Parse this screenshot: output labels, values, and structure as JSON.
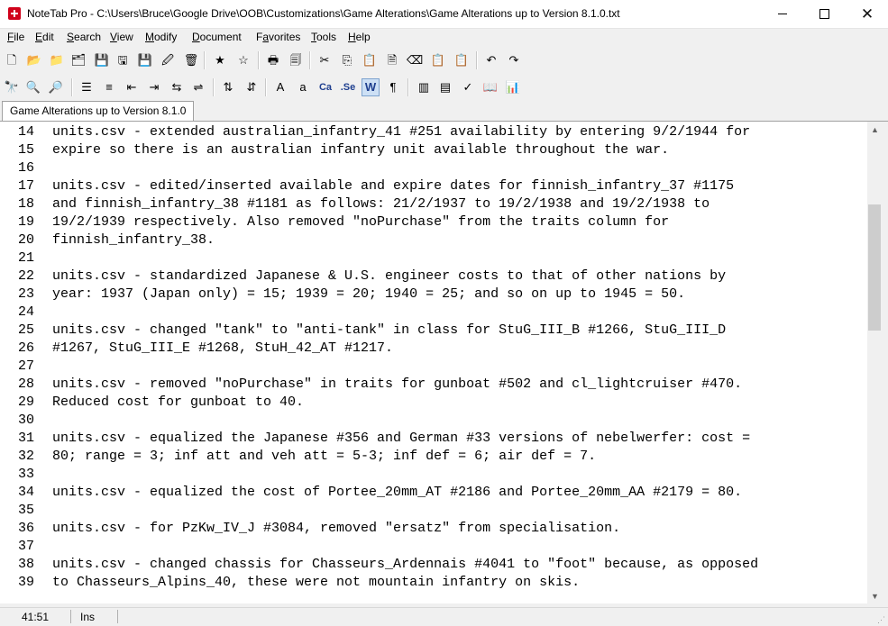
{
  "window": {
    "title": "NoteTab Pro  -  C:\\Users\\Bruce\\Google Drive\\OOB\\Customizations\\Game Alterations\\Game Alterations up to Version 8.1.0.txt"
  },
  "menu": [
    {
      "label": "File",
      "key": "F",
      "rest": "ile"
    },
    {
      "label": "Edit",
      "key": "E",
      "rest": "dit"
    },
    {
      "label": "Search",
      "key": "S",
      "rest": "earch"
    },
    {
      "label": "View",
      "key": "V",
      "rest": "iew"
    },
    {
      "label": "Modify",
      "key": "M",
      "rest": "odify"
    },
    {
      "label": "Document",
      "key": "D",
      "rest": "ocument"
    },
    {
      "label": "Favorites",
      "key": "a",
      "pre": "F",
      "rest": "vorites"
    },
    {
      "label": "Tools",
      "key": "T",
      "rest": "ools"
    },
    {
      "label": "Help",
      "key": "H",
      "rest": "elp"
    }
  ],
  "toolbar1": [
    {
      "icon": "new-document-icon",
      "glyph": "🗋"
    },
    {
      "icon": "open-folder-icon",
      "glyph": "📂"
    },
    {
      "icon": "open-folder-alt-icon",
      "glyph": "📁"
    },
    {
      "icon": "open-multiple-icon",
      "glyph": "🗂"
    },
    {
      "icon": "save-icon",
      "glyph": "💾"
    },
    {
      "icon": "save-all-icon",
      "glyph": "🖫"
    },
    {
      "icon": "save-as-icon",
      "glyph": "💾"
    },
    {
      "icon": "save-edit-icon",
      "glyph": "🖉"
    },
    {
      "icon": "trash-icon",
      "glyph": "🗑"
    },
    {
      "icon": "favorites-add-icon",
      "glyph": "★"
    },
    {
      "icon": "favorites-icon",
      "glyph": "☆"
    },
    {
      "icon": "print-icon",
      "glyph": "🖶"
    },
    {
      "icon": "print-preview-icon",
      "glyph": "🗐"
    },
    {
      "icon": "cut-icon",
      "glyph": "✂"
    },
    {
      "icon": "copy-icon",
      "glyph": "⎘"
    },
    {
      "icon": "paste-icon",
      "glyph": "📋"
    },
    {
      "icon": "paste-special-icon",
      "glyph": "🗎"
    },
    {
      "icon": "eraser-icon",
      "glyph": "⌫"
    },
    {
      "icon": "clipboard-icon",
      "glyph": "📋"
    },
    {
      "icon": "clipboard-alt-icon",
      "glyph": "📋"
    },
    {
      "icon": "undo-icon",
      "glyph": "↶"
    },
    {
      "icon": "redo-icon",
      "glyph": "↷"
    }
  ],
  "toolbar2": [
    {
      "icon": "binoculars-find-icon",
      "glyph": "🔭"
    },
    {
      "icon": "find-replace-icon",
      "glyph": "🔍"
    },
    {
      "icon": "find-next-icon",
      "glyph": "🔎"
    },
    {
      "icon": "bullet-list-icon",
      "glyph": "☰"
    },
    {
      "icon": "numbered-list-icon",
      "glyph": "≡"
    },
    {
      "icon": "outdent-icon",
      "glyph": "⇤"
    },
    {
      "icon": "indent-icon",
      "glyph": "⇥"
    },
    {
      "icon": "align-icon",
      "glyph": "⇆"
    },
    {
      "icon": "wrap-icon",
      "glyph": "⇌"
    },
    {
      "icon": "sort-ascending-icon",
      "glyph": "⇅"
    },
    {
      "icon": "sort-descending-icon",
      "glyph": "⇵"
    },
    {
      "icon": "uppercase-icon",
      "glyph": "A"
    },
    {
      "icon": "lowercase-icon",
      "glyph": "a"
    },
    {
      "icon": "capitalize-icon",
      "glyph": "Ca"
    },
    {
      "icon": "sentence-case-icon",
      "glyph": ".Se"
    },
    {
      "icon": "word-wrap-icon",
      "glyph": "W"
    },
    {
      "icon": "pilcrow-icon",
      "glyph": "¶"
    },
    {
      "icon": "columns-icon",
      "glyph": "▥"
    },
    {
      "icon": "outline-icon",
      "glyph": "▤"
    },
    {
      "icon": "spellcheck-icon",
      "glyph": "✓"
    },
    {
      "icon": "book-icon",
      "glyph": "📖"
    },
    {
      "icon": "statistics-icon",
      "glyph": "📊"
    }
  ],
  "tab": {
    "label": "Game Alterations up to Version 8.1.0"
  },
  "editor_lines": [
    {
      "n": "14",
      "text": "units.csv - extended australian_infantry_41 #251 availability by entering 9/2/1944 for"
    },
    {
      "n": "15",
      "text": "expire so there is an australian infantry unit available throughout the war."
    },
    {
      "n": "16",
      "text": ""
    },
    {
      "n": "17",
      "text": "units.csv - edited/inserted available and expire dates for finnish_infantry_37 #1175"
    },
    {
      "n": "18",
      "text": "and finnish_infantry_38 #1181 as follows: 21/2/1937 to 19/2/1938 and 19/2/1938 to"
    },
    {
      "n": "19",
      "text": "19/2/1939 respectively. Also removed \"noPurchase\" from the traits column for"
    },
    {
      "n": "20",
      "text": "finnish_infantry_38."
    },
    {
      "n": "21",
      "text": ""
    },
    {
      "n": "22",
      "text": "units.csv - standardized Japanese & U.S. engineer costs to that of other nations by"
    },
    {
      "n": "23",
      "text": "year: 1937 (Japan only) = 15; 1939 = 20; 1940 = 25; and so on up to 1945 = 50."
    },
    {
      "n": "24",
      "text": ""
    },
    {
      "n": "25",
      "text": "units.csv - changed \"tank\" to \"anti-tank\" in class for StuG_III_B #1266, StuG_III_D"
    },
    {
      "n": "26",
      "text": "#1267, StuG_III_E #1268, StuH_42_AT #1217."
    },
    {
      "n": "27",
      "text": ""
    },
    {
      "n": "28",
      "text": "units.csv - removed \"noPurchase\" in traits for gunboat #502 and cl_lightcruiser #470."
    },
    {
      "n": "29",
      "text": "Reduced cost for gunboat to 40."
    },
    {
      "n": "30",
      "text": ""
    },
    {
      "n": "31",
      "text": "units.csv - equalized the Japanese #356 and German #33 versions of nebelwerfer: cost ="
    },
    {
      "n": "32",
      "text": "80; range = 3; inf att and veh att = 5-3; inf def = 6; air def = 7."
    },
    {
      "n": "33",
      "text": ""
    },
    {
      "n": "34",
      "text": "units.csv - equalized the cost of Portee_20mm_AT #2186 and Portee_20mm_AA #2179 = 80."
    },
    {
      "n": "35",
      "text": ""
    },
    {
      "n": "36",
      "text": "units.csv - for PzKw_IV_J #3084, removed \"ersatz\" from specialisation."
    },
    {
      "n": "37",
      "text": ""
    },
    {
      "n": "38",
      "text": "units.csv - changed chassis for Chasseurs_Ardennais #4041 to \"foot\" because, as opposed"
    },
    {
      "n": "39",
      "text": "to Chasseurs_Alpins_40, these were not mountain infantry on skis."
    }
  ],
  "status": {
    "position": "41:51",
    "mode": "Ins"
  },
  "colors": {
    "app_icon": "#d0021b",
    "editor_bg": "#ffffff",
    "chrome_bg": "#f0f0f0"
  }
}
